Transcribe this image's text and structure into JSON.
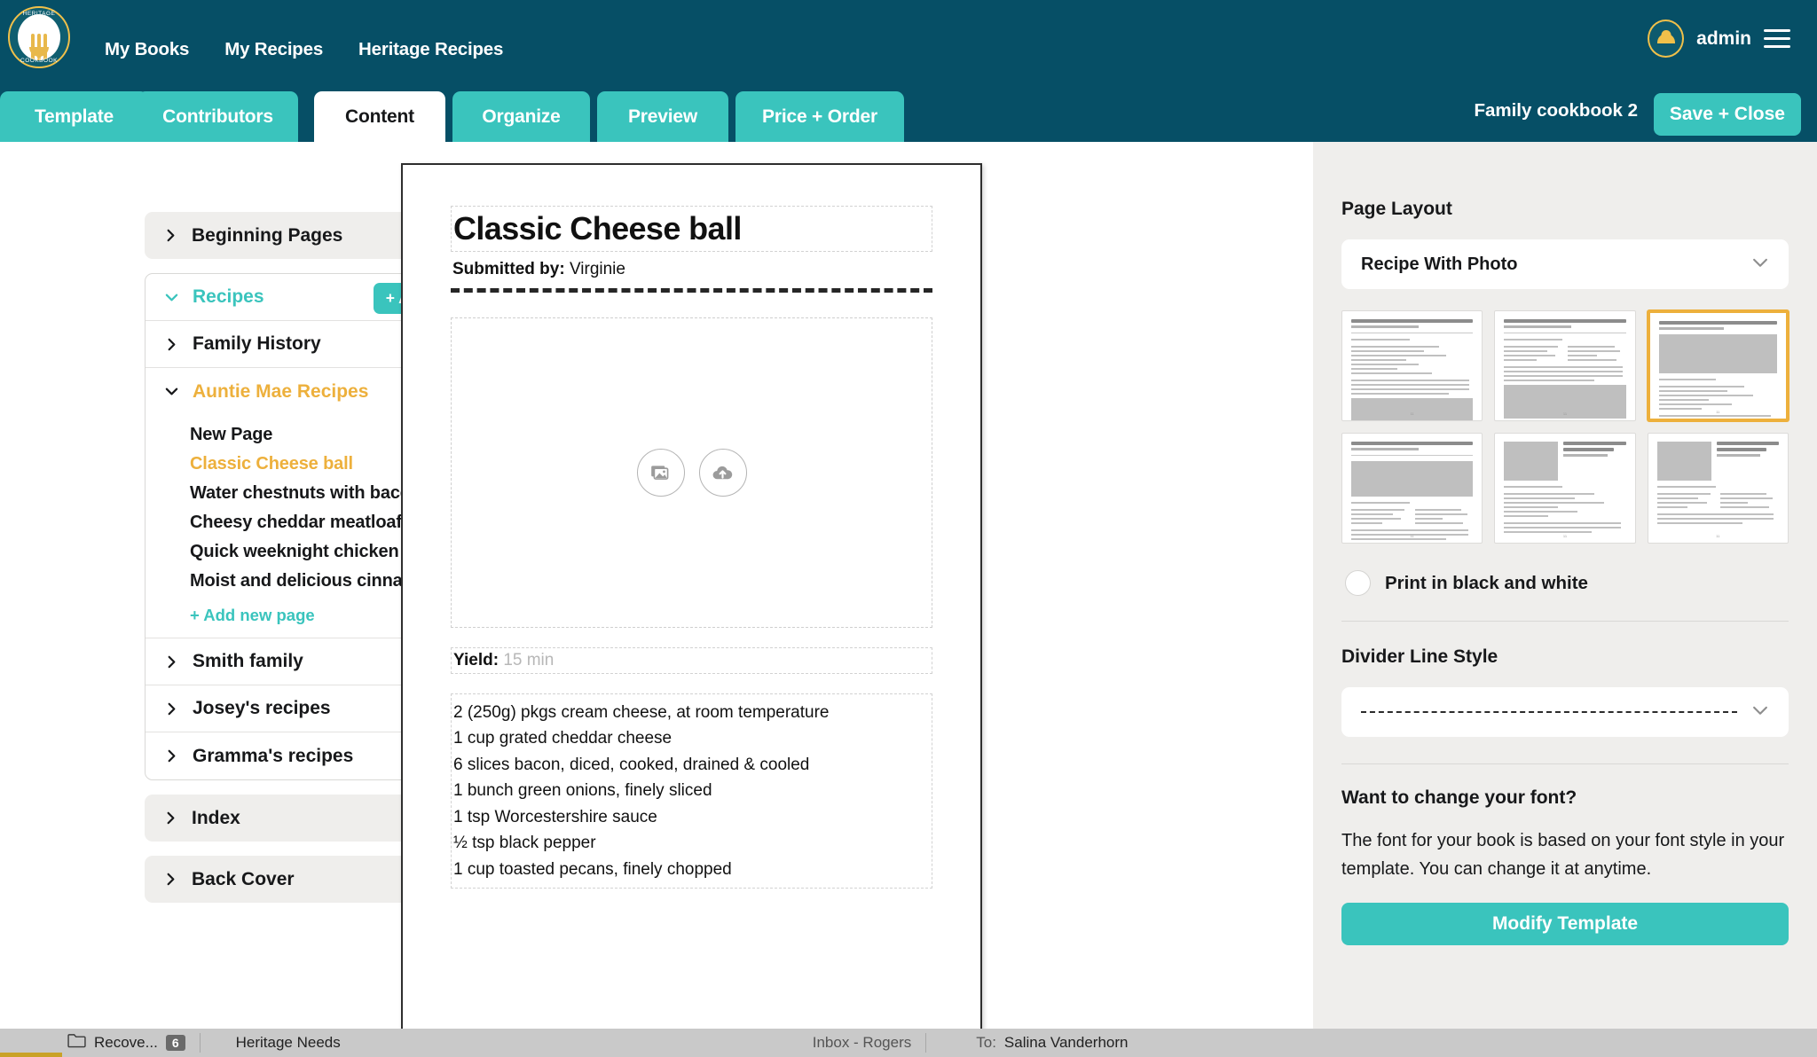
{
  "header": {
    "brand": {
      "icon": "cookbook-logo-icon",
      "ring_top": "HERITAGE",
      "ring_bottom": "COOKBOOK"
    },
    "nav": [
      {
        "label": "My Books"
      },
      {
        "label": "My Recipes"
      },
      {
        "label": "Heritage Recipes"
      }
    ],
    "user": {
      "name": "admin",
      "avatar_icon": "user-avatar-icon",
      "menu_icon": "hamburger-menu-icon"
    },
    "accent_color": "#3ac4bd",
    "header_color": "#064f66",
    "gold_color": "#edb03c"
  },
  "tabs": [
    {
      "label": "Template",
      "active": false
    },
    {
      "label": "Contributors",
      "active": false
    },
    {
      "label": "Content",
      "active": true
    },
    {
      "label": "Organize",
      "active": false
    },
    {
      "label": "Preview",
      "active": false
    },
    {
      "label": "Price + Order",
      "active": false
    }
  ],
  "book": {
    "title": "Family cookbook 2",
    "save_label": "Save + Close"
  },
  "sidebar": {
    "beginning_pages": {
      "label": "Beginning Pages",
      "chevron": "chevron-right-icon",
      "info_icon": "info-icon"
    },
    "recipes": {
      "label": "Recipes",
      "chevron": "chevron-down-icon",
      "add_new_label": "+ Add New"
    },
    "groups": [
      {
        "label": "Family History",
        "chevron": "chevron-right-icon",
        "expanded": false
      },
      {
        "label": "Auntie Mae Recipes",
        "chevron": "chevron-down-icon",
        "expanded": true
      },
      {
        "label": "Smith family",
        "chevron": "chevron-right-icon",
        "expanded": false
      },
      {
        "label": "Josey's recipes",
        "chevron": "chevron-right-icon",
        "expanded": false
      },
      {
        "label": "Gramma's recipes",
        "chevron": "chevron-right-icon",
        "expanded": false
      }
    ],
    "pages": [
      {
        "label": "New Page",
        "active": false
      },
      {
        "label": "Classic Cheese ball",
        "active": true
      },
      {
        "label": "Water chestnuts with bacon",
        "active": false
      },
      {
        "label": "Cheesy cheddar meatloaf",
        "active": false
      },
      {
        "label": "Quick weeknight chicken parmesan",
        "active": false
      },
      {
        "label": "Moist and delicious cinnamon rolls",
        "active": false
      }
    ],
    "add_page_label": "+ Add new page",
    "index": {
      "label": "Index",
      "chevron": "chevron-right-icon"
    },
    "back_cover": {
      "label": "Back Cover",
      "chevron": "chevron-right-icon"
    }
  },
  "recipe": {
    "title": "Classic Cheese ball",
    "submitted_label": "Submitted by:",
    "submitted_by": "Virginie",
    "photo": {
      "gallery_icon": "image-gallery-icon",
      "upload_icon": "cloud-upload-icon"
    },
    "yield_label": "Yield:",
    "yield_placeholder": "15 min",
    "ingredients": [
      "2 (250g) pkgs cream cheese, at room temperature",
      "1 cup grated cheddar cheese",
      "6 slices bacon, diced, cooked, drained & cooled",
      "1 bunch green onions, finely sliced",
      "1 tsp Worcestershire sauce",
      "½ tsp black pepper",
      "1 cup toasted pecans, finely chopped"
    ]
  },
  "right_panel": {
    "page_layout_heading": "Page Layout",
    "page_layout_value": "Recipe With Photo",
    "page_layout_chevron": "chevron-down-icon",
    "layout_thumbs": [
      {
        "id": 1,
        "selected": false,
        "style": "text-then-image"
      },
      {
        "id": 2,
        "selected": false,
        "style": "two-column-then-image"
      },
      {
        "id": 3,
        "selected": true,
        "style": "image-top-text-below"
      },
      {
        "id": 4,
        "selected": false,
        "style": "image-mid-two-column"
      },
      {
        "id": 5,
        "selected": false,
        "style": "image-left-title-right"
      },
      {
        "id": 6,
        "selected": false,
        "style": "image-left-two-column"
      }
    ],
    "bw_label": "Print in black and white",
    "bw_checked": false,
    "divider_heading": "Divider Line Style",
    "divider_value": "dashed",
    "divider_chevron": "chevron-down-icon",
    "font_heading": "Want to change your font?",
    "font_body": "The font for your book is based on your font style in your template. You can change it at anytime.",
    "modify_label": "Modify Template"
  },
  "taskbar": {
    "items": [
      {
        "label": "Recove...",
        "icon": "folder-icon",
        "badge": "6"
      },
      {
        "label": "Heritage Needs",
        "icon": "",
        "badge": ""
      },
      {
        "label": "Inbox - Rogers",
        "icon": "",
        "badge": ""
      },
      {
        "label": "To:",
        "value": "Salina Vanderhorn",
        "icon": "",
        "badge": ""
      }
    ]
  }
}
